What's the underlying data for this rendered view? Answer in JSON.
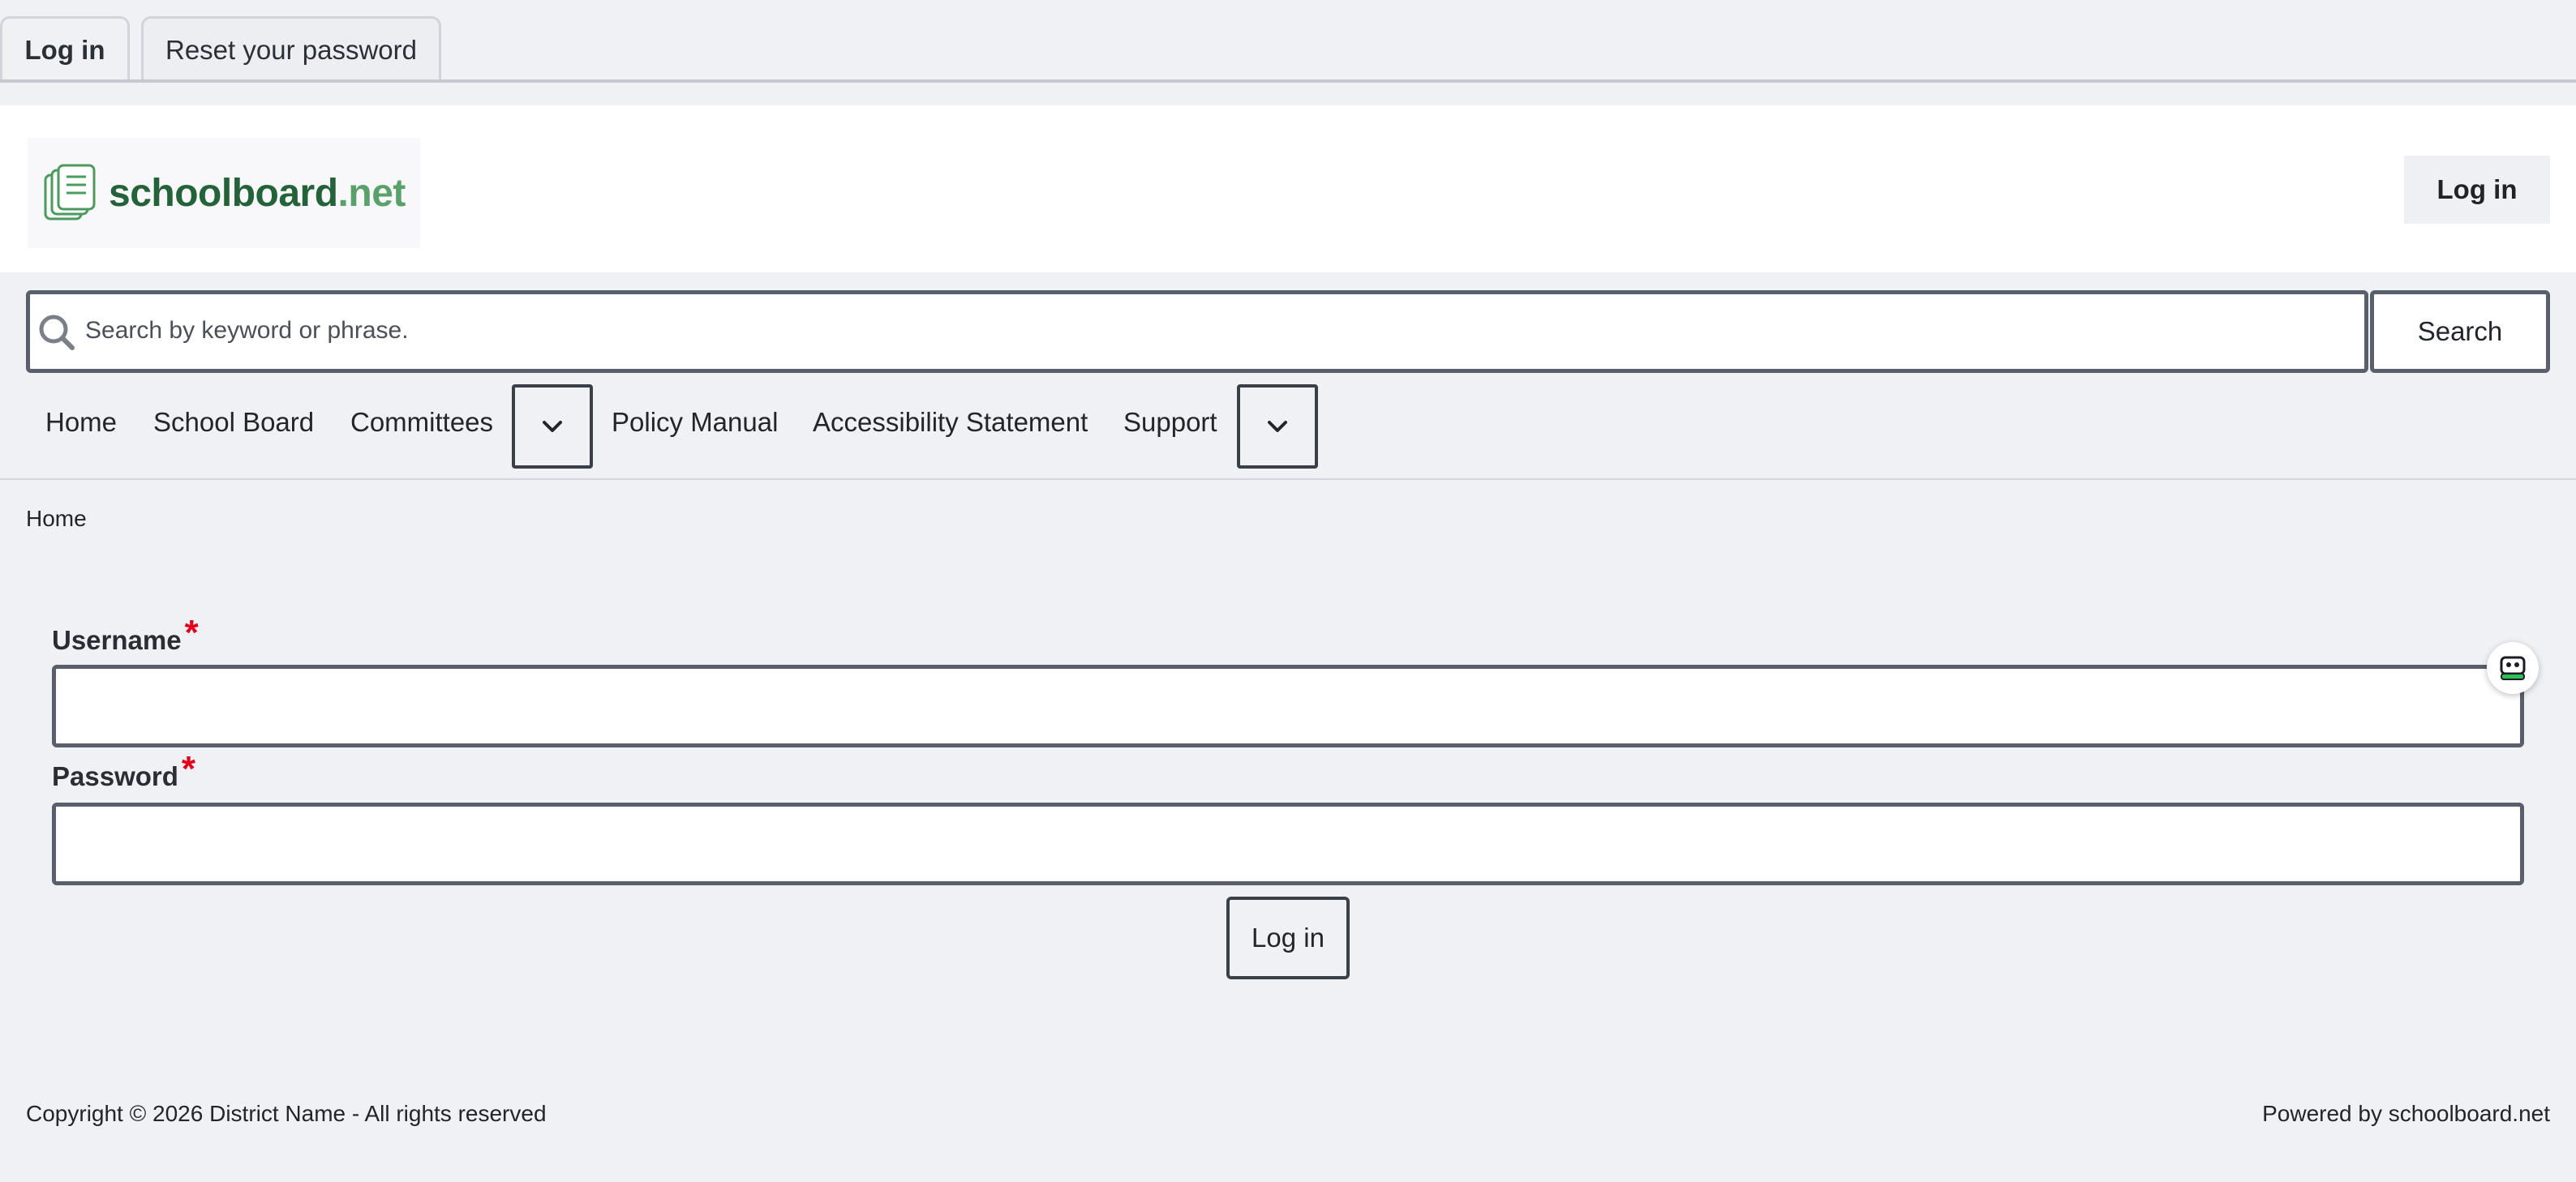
{
  "local_tabs": [
    {
      "label": "Log in",
      "active": true
    },
    {
      "label": "Reset your password",
      "active": false
    }
  ],
  "header": {
    "logo_text_primary": "schoolboard",
    "logo_text_secondary": ".net",
    "login_label": "Log in",
    "icons": {
      "logo": "documents-stack-icon"
    }
  },
  "search": {
    "placeholder": "Search by keyword or phrase.",
    "button_label": "Search",
    "icon": "search-icon"
  },
  "nav": {
    "items": [
      {
        "label": "Home"
      },
      {
        "label": "School Board"
      },
      {
        "label": "Committees",
        "has_submenu": true
      },
      {
        "label": "Policy Manual"
      },
      {
        "label": "Accessibility Statement"
      },
      {
        "label": "Support",
        "has_submenu": true
      }
    ],
    "toggle_icon": "chevron-down-icon"
  },
  "breadcrumb": {
    "items": [
      "Home"
    ]
  },
  "form": {
    "username_label": "Username",
    "password_label": "Password",
    "required_marker": "*",
    "username_value": "",
    "password_value": "",
    "submit_label": "Log in"
  },
  "widget": {
    "icon": "chat-assistant-icon"
  },
  "footer": {
    "copyright": "Copyright © 2026 District Name - All rights reserved",
    "powered_by": "Powered by schoolboard.net"
  },
  "colors": {
    "page_bg": "#f0f1f5",
    "brand_dark_green": "#24633a",
    "brand_light_green": "#5aa06a",
    "required_red": "#e0001b",
    "border": "#5a606b"
  }
}
